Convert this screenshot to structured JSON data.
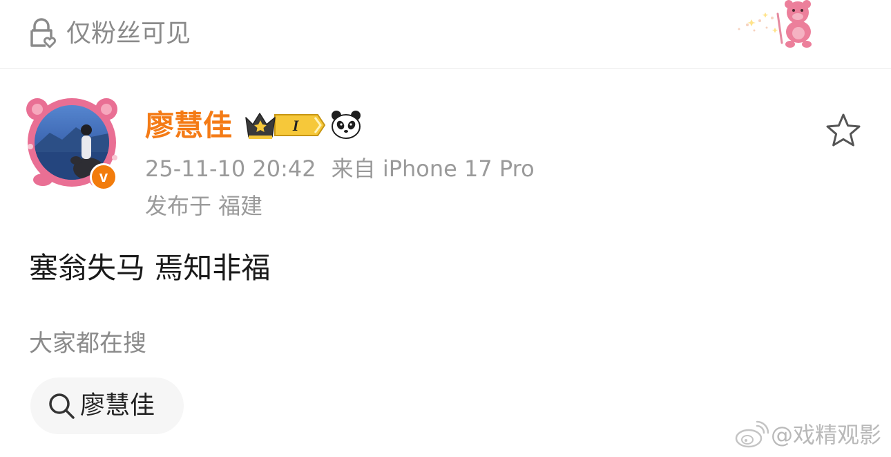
{
  "visibility": {
    "label": "仅粉丝可见",
    "icon": "lock-heart-icon"
  },
  "post": {
    "author": {
      "name": "廖慧佳",
      "verified": true,
      "verified_mark": "v",
      "level_badge_text": "I",
      "avatar_icon": "avatar-image",
      "crown_icon": "crown-badge-icon",
      "panda_icon": "panda-icon"
    },
    "timestamp": "25-11-10 20:42",
    "source": "来自 iPhone 17 Pro",
    "location": "发布于 福建",
    "content": "塞翁失马 焉知非福",
    "favorite_icon": "star-icon"
  },
  "trending": {
    "heading": "大家都在搜",
    "chips": [
      {
        "label": "廖慧佳",
        "icon": "search-icon"
      }
    ]
  },
  "watermark": {
    "text": "@戏精观影",
    "icon": "weibo-logo-icon"
  },
  "colors": {
    "username": "#f47b16",
    "verified": "#f27c0c",
    "meta": "#9a9a9a",
    "chip_bg": "#f6f6f6"
  }
}
